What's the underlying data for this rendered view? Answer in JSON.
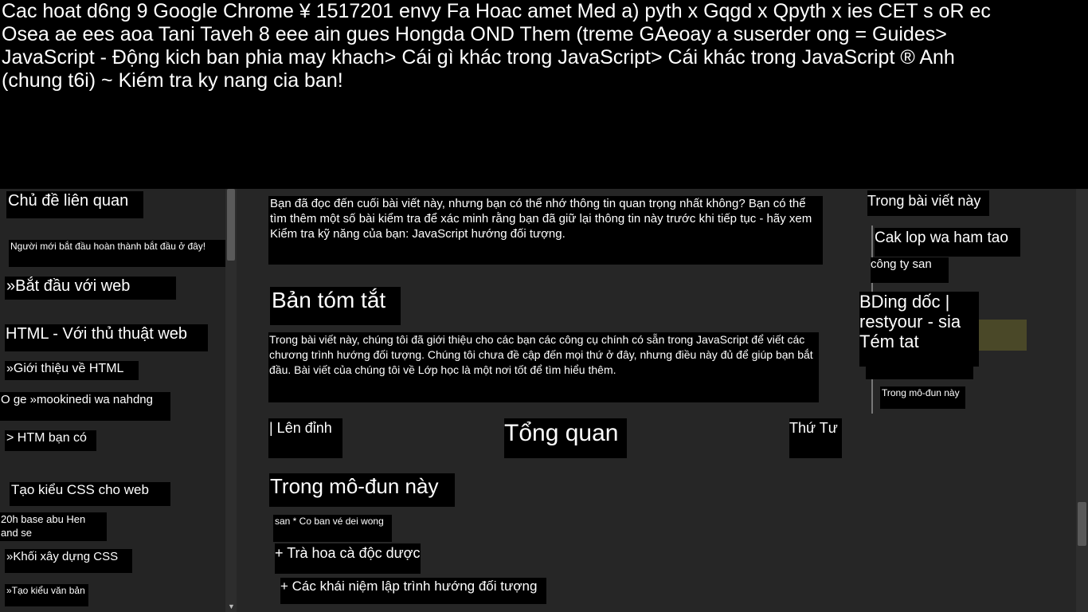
{
  "header_text": [
    "Cac hoat d6ng 9 Google Chrome ¥ 1517201 envy Fa Hoac amet Med a) pyth x Gqgd x Qpyth x ies CET s oR ec",
    "Osea ae ees aoa Tani Taveh 8 eee ain gues Hongda OND Them (treme GAeoay a suserder ong = Guides>",
    "JavaScript - Động kich ban phia may khach> Cái gì khác trong JavaScript> Cái khác trong JavaScript ® Anh",
    "(chung t6i) ~ Kiém tra ky nang cia ban!"
  ],
  "sidebar": {
    "title": "Chủ đề liên quan",
    "beginners_note": "Người mới bắt đầu hoàn thành bắt đầu ở đây!",
    "getting_started": "»Bắt đầu với web",
    "html_heading": "HTML - Với thủ thuật web",
    "html_intro": "»Giới thiệu về HTML",
    "noisy_item": "O ge »mookinedi wa nahdng",
    "htm_item": "> HTM bạn có",
    "css_heading": "Tạo kiểu CSS cho web",
    "css_note_1": "20h base abu Hen",
    "css_note_2": "and se",
    "css_blocks": "»Khối xây dựng CSS",
    "text_styling": "»Tạo kiểu văn bản"
  },
  "main": {
    "intro_paragraph": "Bạn đã đọc đến cuối bài viết này, nhưng bạn có thể nhớ thông tin quan trọng nhất không? Bạn có thể tìm thêm một số bài kiểm tra để xác minh rằng bạn đã giữ lại thông tin này trước khi tiếp tục - hãy xem Kiểm tra kỹ năng của bạn: JavaScript hướng đối tượng.",
    "summary_heading": "Bản tóm tắt",
    "summary_paragraph": "Trong bài viết này, chúng tôi đã giới thiệu cho các bạn các công cụ chính có sẵn trong JavaScript để viết các chương trình hướng đối tượng. Chúng tôi chưa đề cập đến mọi thứ ở đây, nhưng điều này đủ để giúp bạn bắt đầu. Bài viết của chúng tôi về Lớp học là một nơi tốt để tìm hiểu thêm.",
    "nav_up": "| Lên đỉnh",
    "nav_overview": "Tổng quan",
    "nav_next": "Thứ Tư",
    "module_heading": "Trong mô-đun này",
    "module_item_1": "san * Co ban vé dei wong",
    "module_item_2": "+ Trà hoa cà độc dược",
    "module_item_3": "+ Các khái niệm lập trình hướng đối tượng"
  },
  "toc": {
    "title": "Trong bài viết này",
    "item_1": "Cak lop wa ham tao",
    "item_2": "công ty san",
    "item_3_line_1": "BDing dốc |",
    "item_3_line_2": "restyour - sia",
    "item_3_line_3": "Tém tat",
    "item_4": "Trong mô-đun này"
  },
  "colors": {
    "background": "#000000",
    "sidebar": "#242424",
    "main": "#262626",
    "highlight": "#4a4828"
  }
}
